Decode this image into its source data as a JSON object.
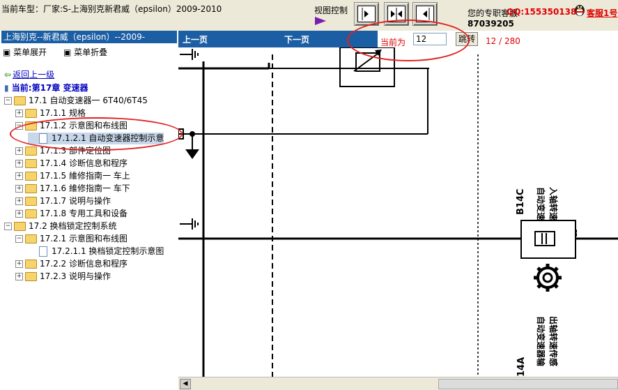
{
  "header": {
    "model_title": "当前车型：厂家:S-上海别克新君威（epsilon）2009-2010",
    "view_control_label": "视图控制",
    "service_label": "您的专职客服",
    "qq_number": "QQ:1553501388",
    "phone_fragment": "87039205",
    "qq_link": "客服1号"
  },
  "sidebar": {
    "header_title": "上海别克--新君威（epsilon）--2009-",
    "expand_menu": "菜单展开",
    "collapse_menu": "菜单折叠",
    "back_link": "返回上一级",
    "current_chapter": "当前:第17章  变速器",
    "tree": [
      {
        "label": "17.1 自动变速器一 6T40/6T45",
        "level": 0,
        "type": "folder",
        "toggle": "−"
      },
      {
        "label": "17.1.1 规格",
        "level": 1,
        "type": "folder",
        "toggle": "+"
      },
      {
        "label": "17.1.2 示意图和布线图",
        "level": 1,
        "type": "folder",
        "toggle": "−"
      },
      {
        "label": "17.1.2.1 自动变速器控制示意",
        "level": 2,
        "type": "doc",
        "toggle": ""
      },
      {
        "label": "17.1.3 部件定位图",
        "level": 1,
        "type": "folder",
        "toggle": "+"
      },
      {
        "label": "17.1.4 诊断信息和程序",
        "level": 1,
        "type": "folder",
        "toggle": "+"
      },
      {
        "label": "17.1.5 維修指南一 车上",
        "level": 1,
        "type": "folder",
        "toggle": "+"
      },
      {
        "label": "17.1.6 維修指南一 车下",
        "level": 1,
        "type": "folder",
        "toggle": "+"
      },
      {
        "label": "17.1.7 说明与操作",
        "level": 1,
        "type": "folder",
        "toggle": "+"
      },
      {
        "label": "17.1.8 专用工具和设备",
        "level": 1,
        "type": "folder",
        "toggle": "+"
      },
      {
        "label": "17.2 换档锁定控制系统",
        "level": 0,
        "type": "folder",
        "toggle": "−"
      },
      {
        "label": "17.2.1 示意图和布线图",
        "level": 1,
        "type": "folder",
        "toggle": "−"
      },
      {
        "label": "17.2.1.1 换档锁定控制示意图",
        "level": 2,
        "type": "doc",
        "toggle": ""
      },
      {
        "label": "17.2.2 诊断信息和程序",
        "level": 1,
        "type": "folder",
        "toggle": "+"
      },
      {
        "label": "17.2.3 说明与操作",
        "level": 1,
        "type": "folder",
        "toggle": "+"
      }
    ]
  },
  "viewer": {
    "prev_label": "上一页",
    "next_label": "下一页",
    "current_label": "当前为",
    "page_value": "12",
    "jump_label": "跳转",
    "page_count": "12 / 280",
    "diagram": {
      "b14c_code": "B14C",
      "b14c_line1": "自动变速器输",
      "b14c_line2": "入轴转速传感",
      "b14c_line3": "器",
      "b14a_code": "14A",
      "b14a_line1": "自动变速器输",
      "b14a_line2": "出轴转速传感"
    }
  },
  "colors": {
    "nav_blue": "#1c5ea4",
    "alert_red": "#e00000",
    "folder_yellow": "#f7d46b"
  }
}
